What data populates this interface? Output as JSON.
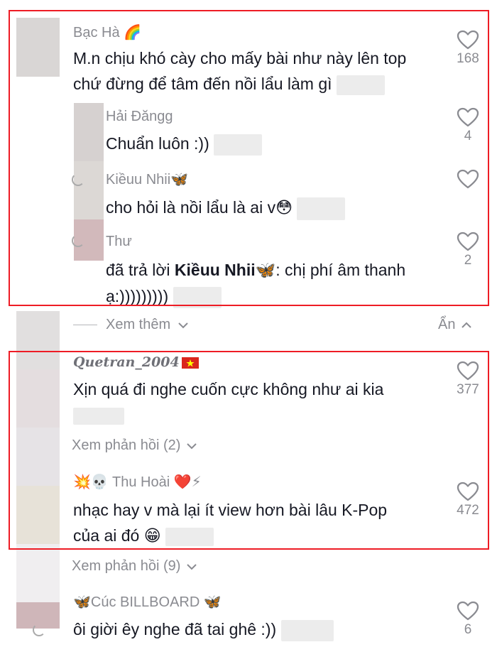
{
  "comments": [
    {
      "username": "Bạc Hà",
      "username_emoji": "🌈",
      "text_line1": "M.n chịu khó cày cho mấy bài như này lên top",
      "text_line2": "chứ đừng để tâm đến nồi lẩu làm gì",
      "likes": "168"
    },
    {
      "username": "Hải Đăngg",
      "text": "Chuẩn luôn :))",
      "likes": "4"
    },
    {
      "username": "Kiềuu Nhii",
      "username_emoji": "🦋",
      "text": "cho hỏi là nồi lẩu là ai v",
      "text_emoji": "😳",
      "likes": ""
    },
    {
      "username": "Thư",
      "reply_prefix": "đã trả lời ",
      "reply_to": "Kiềuu Nhii",
      "reply_to_emoji": "🦋",
      "reply_text": ": chị phí âm thanh",
      "text_line2": "ạ:)))))))))",
      "likes": "2"
    },
    {
      "username": "Quetran_2004",
      "username_emoji": "🇻🇳",
      "text": "Xịn quá đi nghe cuốn cực không như ai kia",
      "likes": "377"
    },
    {
      "username_prefix_emoji": "💥💀",
      "username": "Thu Hoài",
      "username_emoji": "❤️⚡",
      "text_line1": "nhạc hay v mà lại ít view hơn bài lâu K-Pop",
      "text_line2": "của ai đó",
      "text_emoji": "😁",
      "likes": "472"
    },
    {
      "username_prefix_emoji": "🦋",
      "username": "Cúc BILLBOARD",
      "username_emoji": "🦋",
      "text": "ôi giời êy nghe đã tai ghê :))",
      "likes": "6"
    }
  ],
  "controls": {
    "see_more": "Xem thêm",
    "hide": "Ẩn",
    "view_replies_1": "Xem phản hồi (2)",
    "view_replies_2": "Xem phản hồi (9)"
  },
  "icons": {
    "like": "heart-outline-icon",
    "expand": "chevron-down-icon",
    "collapse": "chevron-up-icon"
  },
  "colors": {
    "highlight_frame": "#ee1c25",
    "secondary_text": "#8a8b91",
    "primary_text": "#161823"
  }
}
